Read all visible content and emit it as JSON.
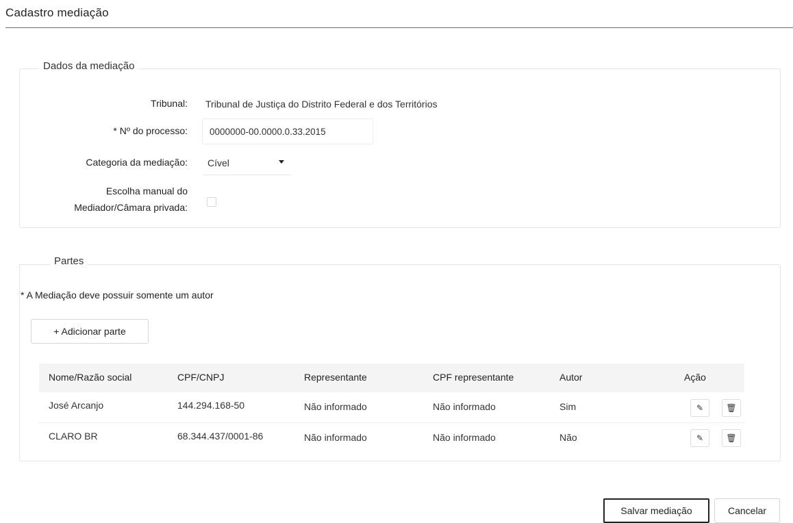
{
  "page": {
    "title": "Cadastro mediação"
  },
  "dados": {
    "legend": "Dados da mediação",
    "tribunal_label": "Tribunal:",
    "tribunal_value": "Tribunal de Justiça do Distrito Federal e dos Territórios",
    "processo_label": "* Nº do processo:",
    "processo_value": "0000000-00.0000.0.33.2015",
    "categoria_label": "Categoria da mediação:",
    "categoria_value": "Cível",
    "escolha_label_line1": "Escolha manual do",
    "escolha_label_line2": "Mediador/Câmara privada:",
    "escolha_checked": false
  },
  "partes": {
    "legend": "Partes",
    "note": "* A Mediação deve possuir somente um autor",
    "add_button": "+ Adicionar parte",
    "columns": [
      "Nome/Razão social",
      "CPF/CNPJ",
      "Representante",
      "CPF representante",
      "Autor",
      "Ação"
    ],
    "rows": [
      {
        "nome": "José Arcanjo",
        "cpf": "144.294.168-50",
        "representante": "Não informado",
        "cpf_rep": "Não informado",
        "autor": "Sim"
      },
      {
        "nome": "CLARO BR",
        "cpf": "68.344.437/0001-86",
        "representante": "Não informado",
        "cpf_rep": "Não informado",
        "autor": "Não"
      }
    ],
    "edit_icon": "pencil-icon",
    "delete_icon": "trash-icon"
  },
  "actions": {
    "save": "Salvar mediação",
    "cancel": "Cancelar"
  }
}
